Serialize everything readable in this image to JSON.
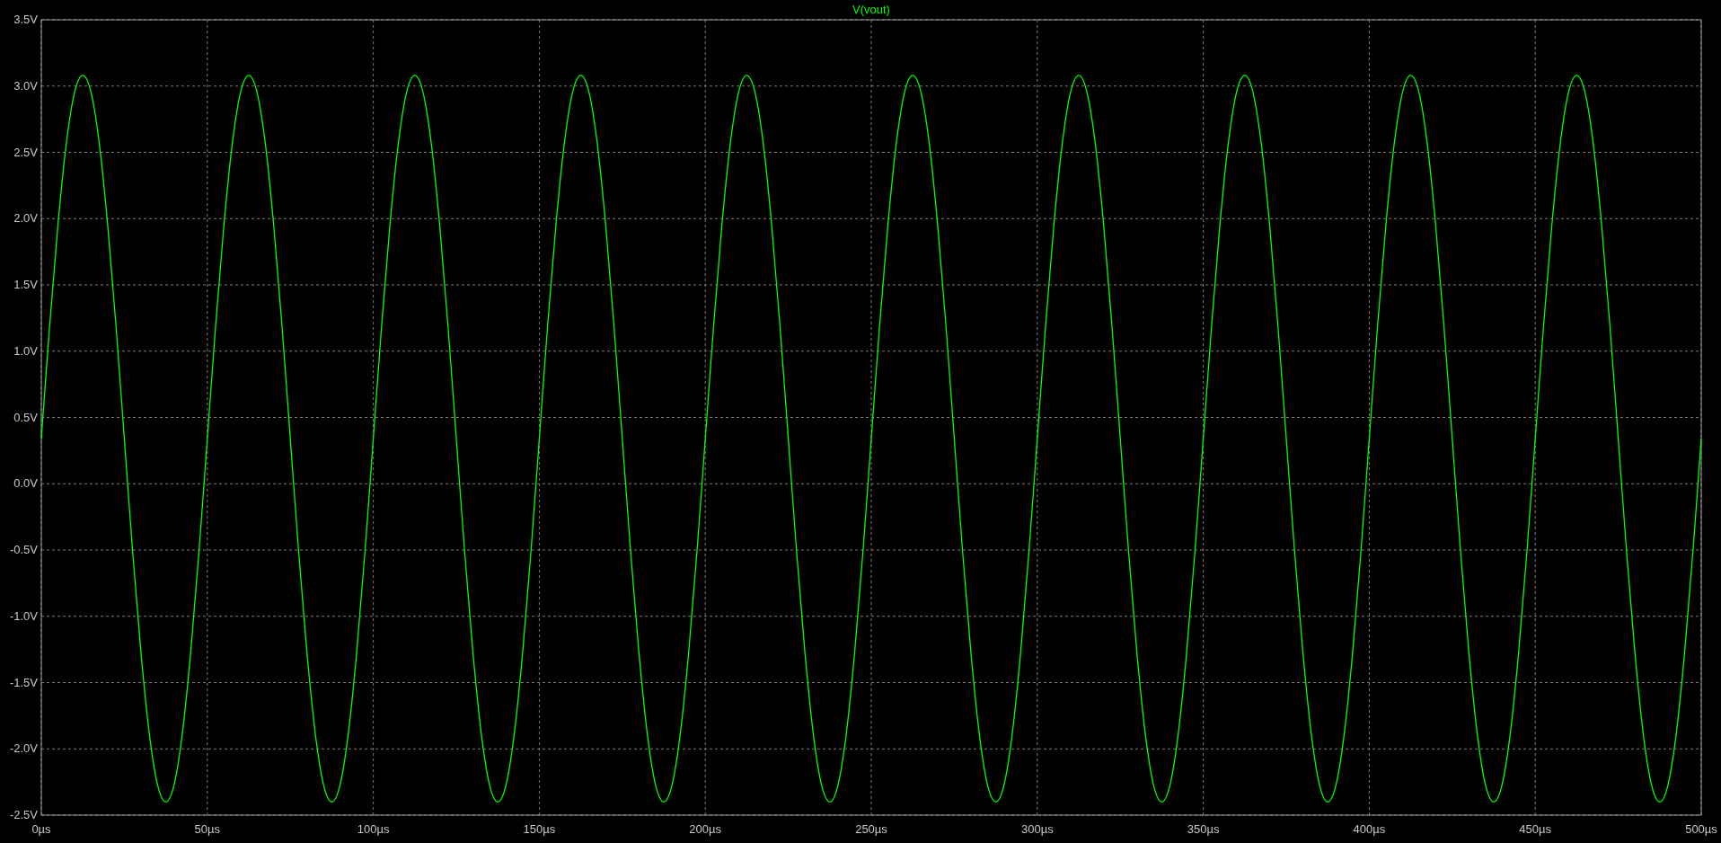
{
  "chart_data": {
    "type": "line",
    "grid": true,
    "xlim": [
      0,
      500
    ],
    "ylim": [
      -2.5,
      3.5
    ],
    "xticks": [
      {
        "value": 0,
        "label": "0µs"
      },
      {
        "value": 50,
        "label": "50µs"
      },
      {
        "value": 100,
        "label": "100µs"
      },
      {
        "value": 150,
        "label": "150µs"
      },
      {
        "value": 200,
        "label": "200µs"
      },
      {
        "value": 250,
        "label": "250µs"
      },
      {
        "value": 300,
        "label": "300µs"
      },
      {
        "value": 350,
        "label": "350µs"
      },
      {
        "value": 400,
        "label": "400µs"
      },
      {
        "value": 450,
        "label": "450µs"
      },
      {
        "value": 500,
        "label": "500µs"
      }
    ],
    "yticks": [
      {
        "value": 3.5,
        "label": "3.5V"
      },
      {
        "value": 3.0,
        "label": "3.0V"
      },
      {
        "value": 2.5,
        "label": "2.5V"
      },
      {
        "value": 2.0,
        "label": "2.0V"
      },
      {
        "value": 1.5,
        "label": "1.5V"
      },
      {
        "value": 1.0,
        "label": "1.0V"
      },
      {
        "value": 0.5,
        "label": "0.5V"
      },
      {
        "value": 0,
        "label": "0.0V"
      },
      {
        "value": -0.5,
        "label": "-0.5V"
      },
      {
        "value": -1.0,
        "label": "-1.0V"
      },
      {
        "value": -1.5,
        "label": "-1.5V"
      },
      {
        "value": -2.0,
        "label": "-2.0V"
      },
      {
        "value": -2.5,
        "label": "-2.5V"
      }
    ],
    "x": [
      0,
      2.5,
      5,
      7.5,
      10,
      12.5,
      15,
      17.5,
      20,
      22.5,
      25,
      27.5,
      30,
      32.5,
      35,
      37.5,
      40,
      42.5,
      45,
      47.5,
      50,
      52.5,
      55,
      57.5,
      60,
      62.5,
      65,
      67.5,
      70,
      72.5,
      75,
      77.5,
      80,
      82.5,
      85,
      87.5,
      90,
      92.5,
      95,
      97.5,
      100,
      102.5,
      105,
      107.5,
      110,
      112.5,
      115,
      117.5,
      120,
      122.5,
      125,
      127.5,
      130,
      132.5,
      135,
      137.5,
      140,
      142.5,
      145,
      147.5,
      150,
      152.5,
      155,
      157.5,
      160,
      162.5,
      165,
      167.5,
      170,
      172.5,
      175,
      177.5,
      180,
      182.5,
      185,
      187.5,
      190,
      192.5,
      195,
      197.5,
      200,
      202.5,
      205,
      207.5,
      210,
      212.5,
      215,
      217.5,
      220,
      222.5,
      225,
      227.5,
      230,
      232.5,
      235,
      237.5,
      240,
      242.5,
      245,
      247.5,
      250,
      252.5,
      255,
      257.5,
      260,
      262.5,
      265,
      267.5,
      270,
      272.5,
      275,
      277.5,
      280,
      282.5,
      285,
      287.5,
      290,
      292.5,
      295,
      297.5,
      300,
      302.5,
      305,
      307.5,
      310,
      312.5,
      315,
      317.5,
      320,
      322.5,
      325,
      327.5,
      330,
      332.5,
      335,
      337.5,
      340,
      342.5,
      345,
      347.5,
      350,
      352.5,
      355,
      357.5,
      360,
      362.5,
      365,
      367.5,
      370,
      372.5,
      375,
      377.5,
      380,
      382.5,
      385,
      387.5,
      390,
      392.5,
      395,
      397.5,
      400,
      402.5,
      405,
      407.5,
      410,
      412.5,
      415,
      417.5,
      420,
      422.5,
      425,
      427.5,
      430,
      432.5,
      435,
      437.5,
      440,
      442.5,
      445,
      447.5,
      450,
      452.5,
      455,
      457.5,
      460,
      462.5,
      465,
      467.5,
      470,
      472.5,
      475,
      477.5,
      480,
      482.5,
      485,
      487.5,
      490,
      492.5,
      495,
      497.5,
      500
    ],
    "series": [
      {
        "name": "V(vout)",
        "color": "#00ff00",
        "values": [
          0.34,
          1.19,
          1.95,
          2.56,
          2.95,
          3.08,
          2.95,
          2.56,
          1.95,
          1.19,
          0.34,
          -0.51,
          -1.27,
          -1.88,
          -2.27,
          -2.4,
          -2.27,
          -1.88,
          -1.27,
          -0.51,
          0.34,
          1.19,
          1.95,
          2.56,
          2.95,
          3.08,
          2.95,
          2.56,
          1.95,
          1.19,
          0.34,
          -0.51,
          -1.27,
          -1.88,
          -2.27,
          -2.4,
          -2.27,
          -1.88,
          -1.27,
          -0.51,
          0.34,
          1.19,
          1.95,
          2.56,
          2.95,
          3.08,
          2.95,
          2.56,
          1.95,
          1.19,
          0.34,
          -0.51,
          -1.27,
          -1.88,
          -2.27,
          -2.4,
          -2.27,
          -1.88,
          -1.27,
          -0.51,
          0.34,
          1.19,
          1.95,
          2.56,
          2.95,
          3.08,
          2.95,
          2.56,
          1.95,
          1.19,
          0.34,
          -0.51,
          -1.27,
          -1.88,
          -2.27,
          -2.4,
          -2.27,
          -1.88,
          -1.27,
          -0.51,
          0.34,
          1.19,
          1.95,
          2.56,
          2.95,
          3.08,
          2.95,
          2.56,
          1.95,
          1.19,
          0.34,
          -0.51,
          -1.27,
          -1.88,
          -2.27,
          -2.4,
          -2.27,
          -1.88,
          -1.27,
          -0.51,
          0.34,
          1.19,
          1.95,
          2.56,
          2.95,
          3.08,
          2.95,
          2.56,
          1.95,
          1.19,
          0.34,
          -0.51,
          -1.27,
          -1.88,
          -2.27,
          -2.4,
          -2.27,
          -1.88,
          -1.27,
          -0.51,
          0.34,
          1.19,
          1.95,
          2.56,
          2.95,
          3.08,
          2.95,
          2.56,
          1.95,
          1.19,
          0.34,
          -0.51,
          -1.27,
          -1.88,
          -2.27,
          -2.4,
          -2.27,
          -1.88,
          -1.27,
          -0.51,
          0.34,
          1.19,
          1.95,
          2.56,
          2.95,
          3.08,
          2.95,
          2.56,
          1.95,
          1.19,
          0.34,
          -0.51,
          -1.27,
          -1.88,
          -2.27,
          -2.4,
          -2.27,
          -1.88,
          -1.27,
          -0.51,
          0.34,
          1.19,
          1.95,
          2.56,
          2.95,
          3.08,
          2.95,
          2.56,
          1.95,
          1.19,
          0.34,
          -0.51,
          -1.27,
          -1.88,
          -2.27,
          -2.4,
          -2.27,
          -1.88,
          -1.27,
          -0.51,
          0.34,
          1.19,
          1.95,
          2.56,
          2.95,
          3.08,
          2.95,
          2.56,
          1.95,
          1.19,
          0.34,
          -0.51,
          -1.27,
          -1.88,
          -2.27,
          -2.4,
          -2.27,
          -1.88,
          -1.27,
          -0.51,
          0.34
        ]
      }
    ]
  }
}
